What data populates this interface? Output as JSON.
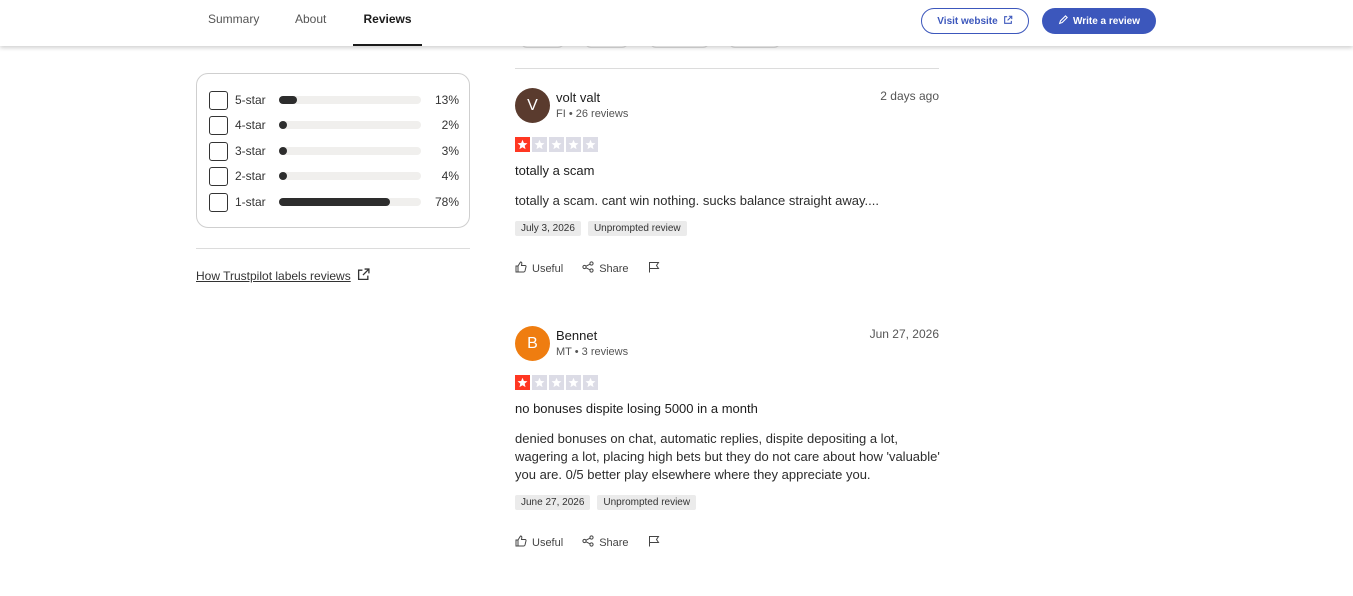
{
  "nav": {
    "tabs": [
      {
        "label": "Summary"
      },
      {
        "label": "About"
      },
      {
        "label": "Reviews"
      }
    ],
    "active_tab": "Reviews",
    "visit_website_label": "Visit website",
    "write_review_label": "Write a review",
    "accent_color": "#3c57bc"
  },
  "rating_filter": {
    "rows": [
      {
        "label": "5-star",
        "percent_text": "13%",
        "fraction": 0.13
      },
      {
        "label": "4-star",
        "percent_text": "2%",
        "fraction": 0.02
      },
      {
        "label": "3-star",
        "percent_text": "3%",
        "fraction": 0.03
      },
      {
        "label": "2-star",
        "percent_text": "4%",
        "fraction": 0.04
      },
      {
        "label": "1-star",
        "percent_text": "78%",
        "fraction": 0.78
      }
    ],
    "how_link_label": "How Trustpilot labels reviews"
  },
  "reviews": [
    {
      "avatar_letter": "V",
      "avatar_color": "#5a3b2e",
      "name": "volt valt",
      "meta": "FI • 26 reviews",
      "date": "2 days ago",
      "rating": 1,
      "title": "totally a scam",
      "body": "totally a scam. cant win nothing. sucks balance straight away....",
      "experience_date": "July 3, 2026",
      "tag": "Unprompted review",
      "useful_label": "Useful",
      "share_label": "Share"
    },
    {
      "avatar_letter": "B",
      "avatar_color": "#ef7d10",
      "name": "Bennet",
      "meta": "MT • 3 reviews",
      "date": "Jun 27, 2026",
      "rating": 1,
      "title": "no bonuses dispite losing 5000 in a month",
      "body": "denied bonuses on chat, automatic replies, dispite depositing a lot, wagering a lot, placing high bets but they do not care about how 'valuable' you are. 0/5 better play elsewhere where they appreciate you.",
      "experience_date": "June 27, 2026",
      "tag": "Unprompted review",
      "useful_label": "Useful",
      "share_label": "Share"
    }
  ],
  "colors": {
    "star_active": "#ff3722",
    "star_inactive": "#dcdce6"
  }
}
